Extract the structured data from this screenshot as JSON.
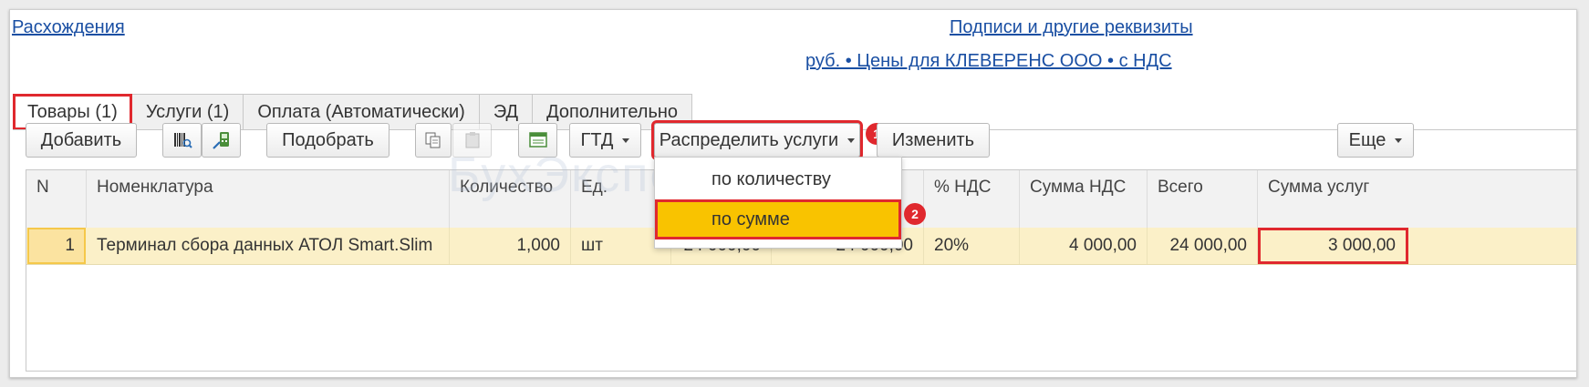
{
  "links": {
    "discrepancies": "Расхождения",
    "signatures": "Подписи и другие реквизиты",
    "prices": "руб. • Цены для КЛЕВЕРЕНС ООО • с НДС"
  },
  "tabs": [
    "Товары (1)",
    "Услуги (1)",
    "Оплата (Автоматически)",
    "ЭД",
    "Дополнительно"
  ],
  "toolbar": {
    "add": "Добавить",
    "select": "Подобрать",
    "gtd": "ГТД",
    "distribute": "Распределить услуги",
    "change": "Изменить",
    "more": "Еще"
  },
  "dropdown": {
    "items": [
      "по количеству",
      "по сумме"
    ],
    "selected": "по сумме"
  },
  "badges": [
    "1",
    "2"
  ],
  "watermark": "БухЭксперт",
  "table": {
    "headers": [
      "N",
      "Номенклатура",
      "Количество",
      "Ед.",
      "",
      "",
      "% НДС",
      "Сумма НДС",
      "Всего",
      "Сумма услуг"
    ],
    "rows": [
      [
        "1",
        "Терминал сбора данных АТОЛ Smart.Slim",
        "1,000",
        "шт",
        "24 000,00",
        "24 000,00",
        "20%",
        "4 000,00",
        "24 000,00",
        "3 000,00"
      ]
    ]
  },
  "colors": {
    "link": "#1a4fa3",
    "highlight": "#e0282e",
    "selected_menu": "#f9c300",
    "row": "#fbf0c8"
  }
}
